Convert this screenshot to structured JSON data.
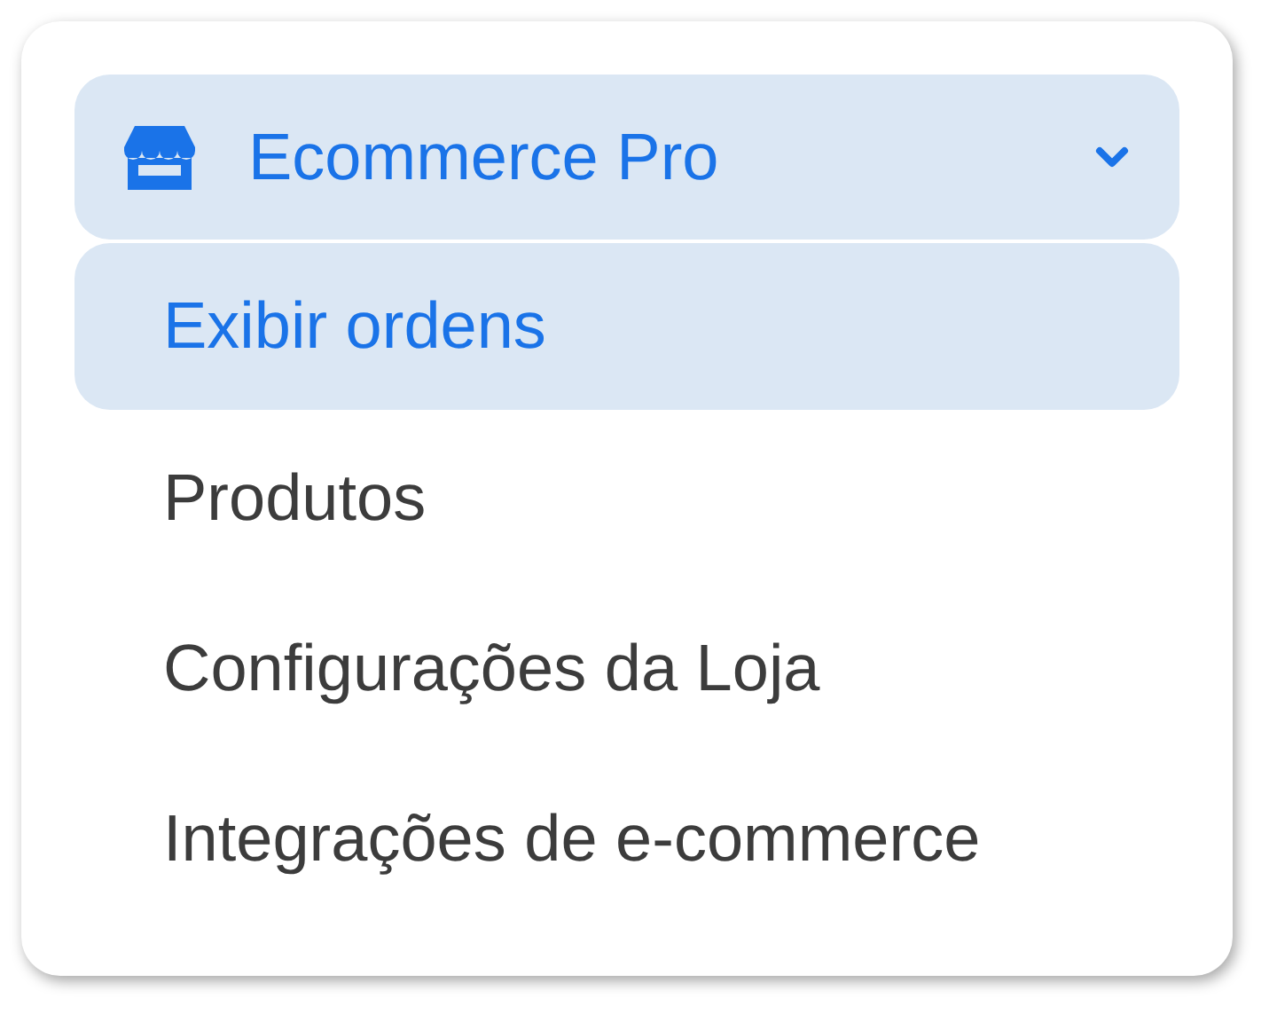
{
  "menu": {
    "title": "Ecommerce Pro",
    "expanded": true,
    "items": [
      {
        "label": "Exibir ordens",
        "selected": true
      },
      {
        "label": "Produtos",
        "selected": false
      },
      {
        "label": "Configurações da Loja",
        "selected": false
      },
      {
        "label": "Integrações de e-commerce",
        "selected": false
      }
    ]
  }
}
